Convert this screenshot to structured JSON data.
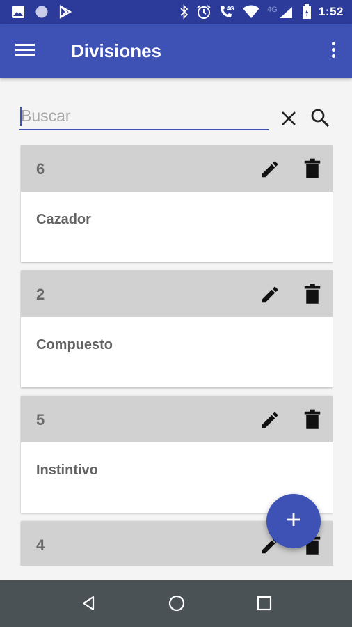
{
  "status_bar": {
    "time": "1:52",
    "network_label": "4G",
    "left_icons": [
      "image-icon",
      "circle-icon",
      "play-store-icon"
    ],
    "right_icons": [
      "bluetooth-icon",
      "alarm-icon",
      "wifi-calling-icon",
      "wifi-icon",
      "signal-icon",
      "battery-icon"
    ]
  },
  "app_bar": {
    "title": "Divisiones",
    "menu_icon": "hamburger-menu-icon",
    "overflow_icon": "more-vert-icon"
  },
  "search": {
    "placeholder": "Buscar",
    "value": "",
    "clear_icon": "close-icon",
    "search_icon": "search-icon"
  },
  "divisions": [
    {
      "number": "6",
      "name": "Cazador"
    },
    {
      "number": "2",
      "name": "Compuesto"
    },
    {
      "number": "5",
      "name": "Instintivo"
    },
    {
      "number": "4",
      "name": ""
    }
  ],
  "card_actions": {
    "edit_icon": "pencil-icon",
    "delete_icon": "trash-icon"
  },
  "fab": {
    "icon": "plus-icon"
  },
  "nav_bar": {
    "back_icon": "back-triangle-icon",
    "home_icon": "home-circle-icon",
    "recents_icon": "recents-square-icon"
  },
  "colors": {
    "status_bar": "#2c3b99",
    "app_bar": "#3e51b5",
    "card_header": "#d1d1d1",
    "background": "#f4f4f4",
    "nav_bar": "#4b5256"
  }
}
